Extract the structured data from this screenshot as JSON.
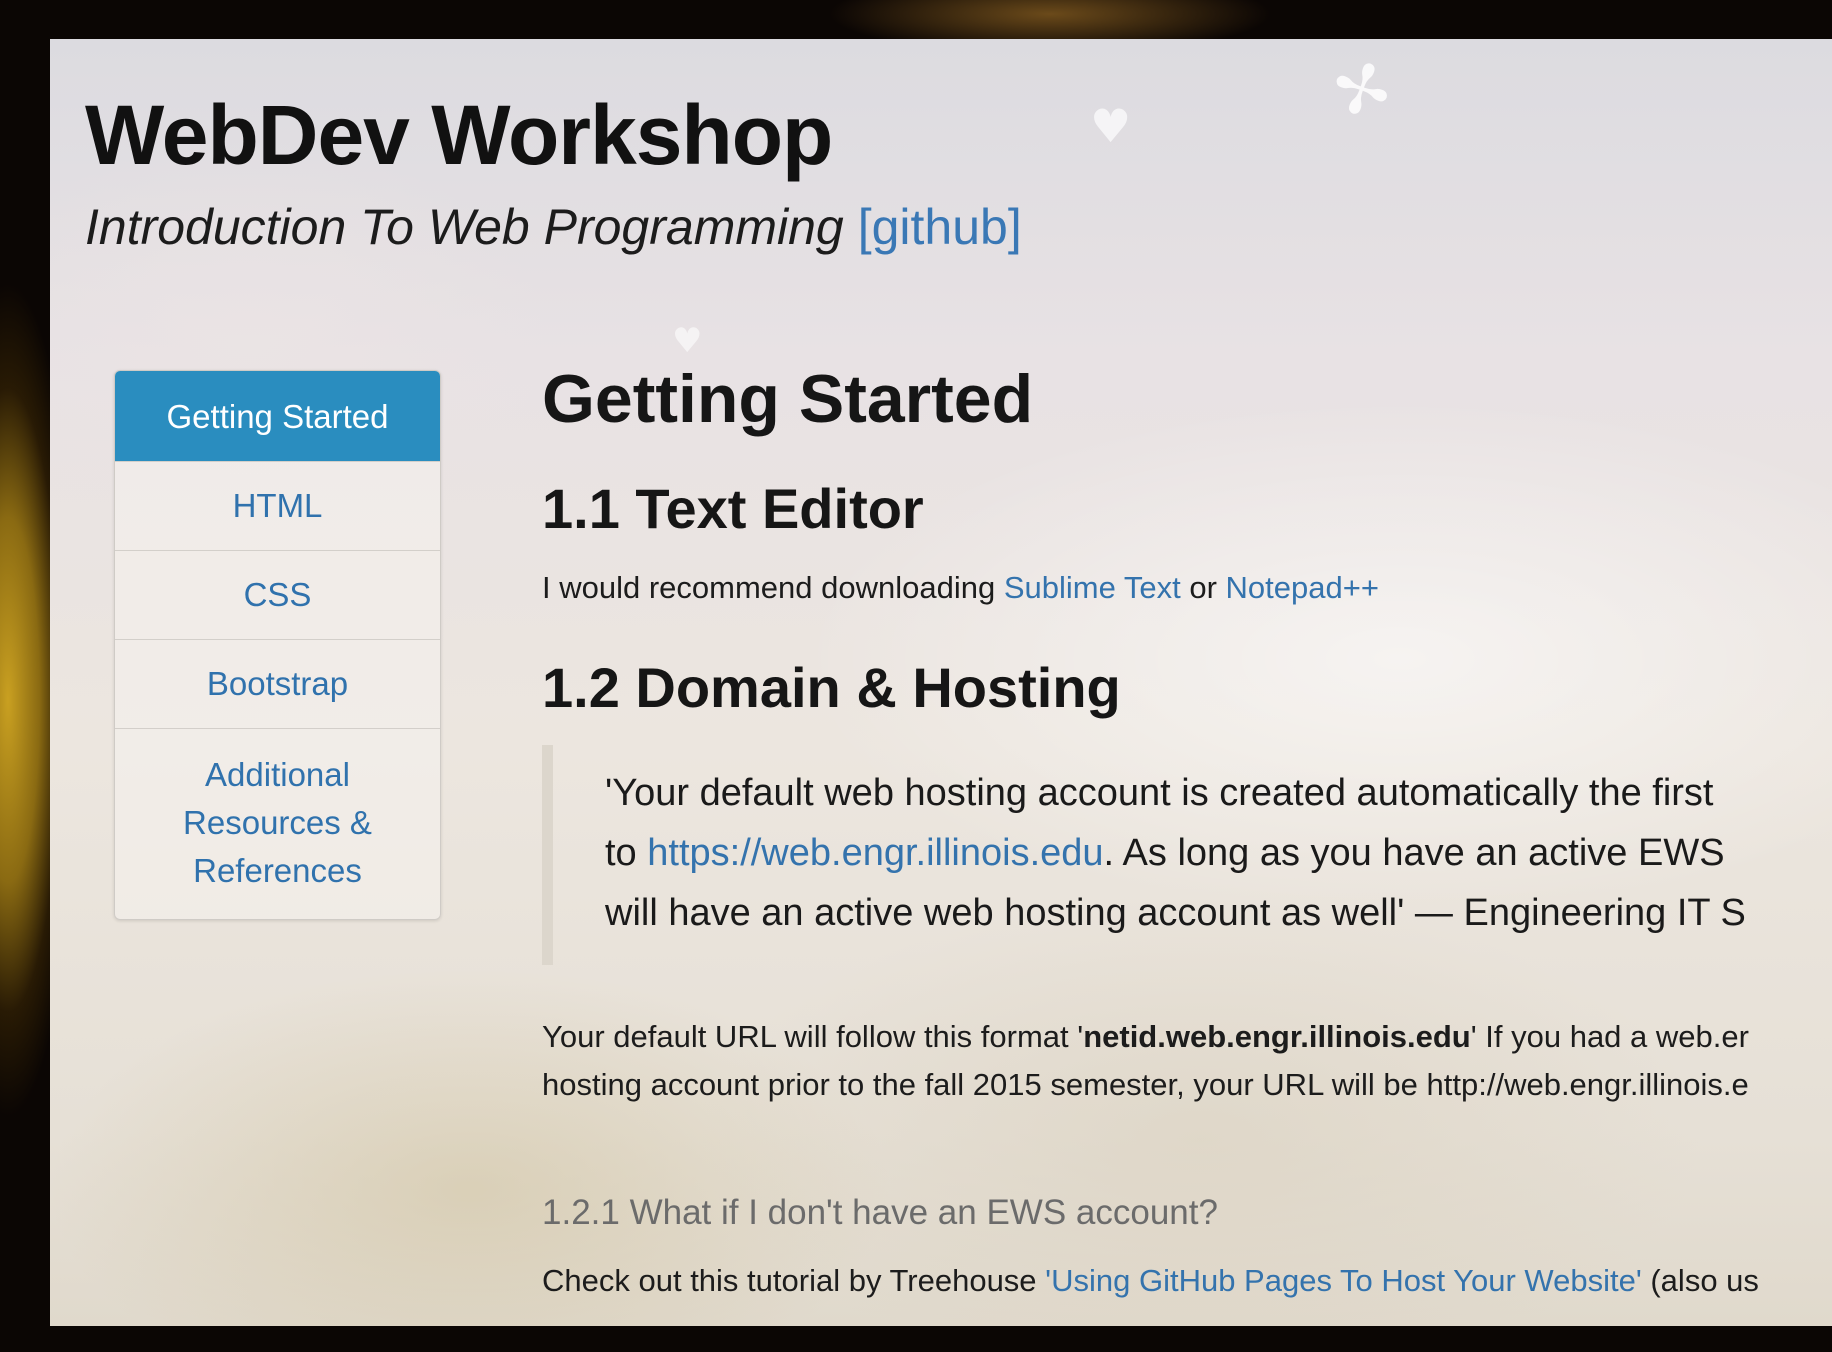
{
  "site": {
    "title": "WebDev Workshop",
    "subtitle": "Introduction To Web Programming",
    "github_link": "[github]"
  },
  "sidebar": {
    "items": [
      {
        "label": "Getting Started",
        "active": true
      },
      {
        "label": "HTML"
      },
      {
        "label": "CSS"
      },
      {
        "label": "Bootstrap"
      },
      {
        "lines": [
          "Additional",
          "Resources &",
          "References"
        ]
      }
    ]
  },
  "content": {
    "title": "Getting Started",
    "text_editor": {
      "heading": "1.1 Text Editor",
      "text_before": "I would recommend downloading ",
      "link1": "Sublime Text",
      "text_mid": " or ",
      "link2": "Notepad++"
    },
    "domain_hosting": {
      "heading": "1.2 Domain & Hosting",
      "quote": {
        "line1": "'Your default web hosting account is created automatically the first",
        "line2_before": "to ",
        "line2_link": "https://web.engr.illinois.edu",
        "line2_after": ". As long as you have an active EWS",
        "line3": "will have an active web hosting account as well' — Engineering IT S"
      },
      "url_para": {
        "text1": "Your default URL will follow this format '",
        "bold": "netid.web.engr.illinois.edu",
        "text2": "' If you had a web.er",
        "line2": "hosting account prior to the fall 2015 semester, your URL will be http://web.engr.illinois.e"
      }
    },
    "no_ews": {
      "heading": "1.2.1 What if I don't have an EWS account?",
      "text_before": "Check out this tutorial by Treehouse ",
      "link": "'Using GitHub Pages To Host Your Website'",
      "text_after": " (also us"
    }
  },
  "colors": {
    "link": "#3473ad",
    "nav_active_bg": "#2a8dbf",
    "text": "#1c1c1c"
  }
}
